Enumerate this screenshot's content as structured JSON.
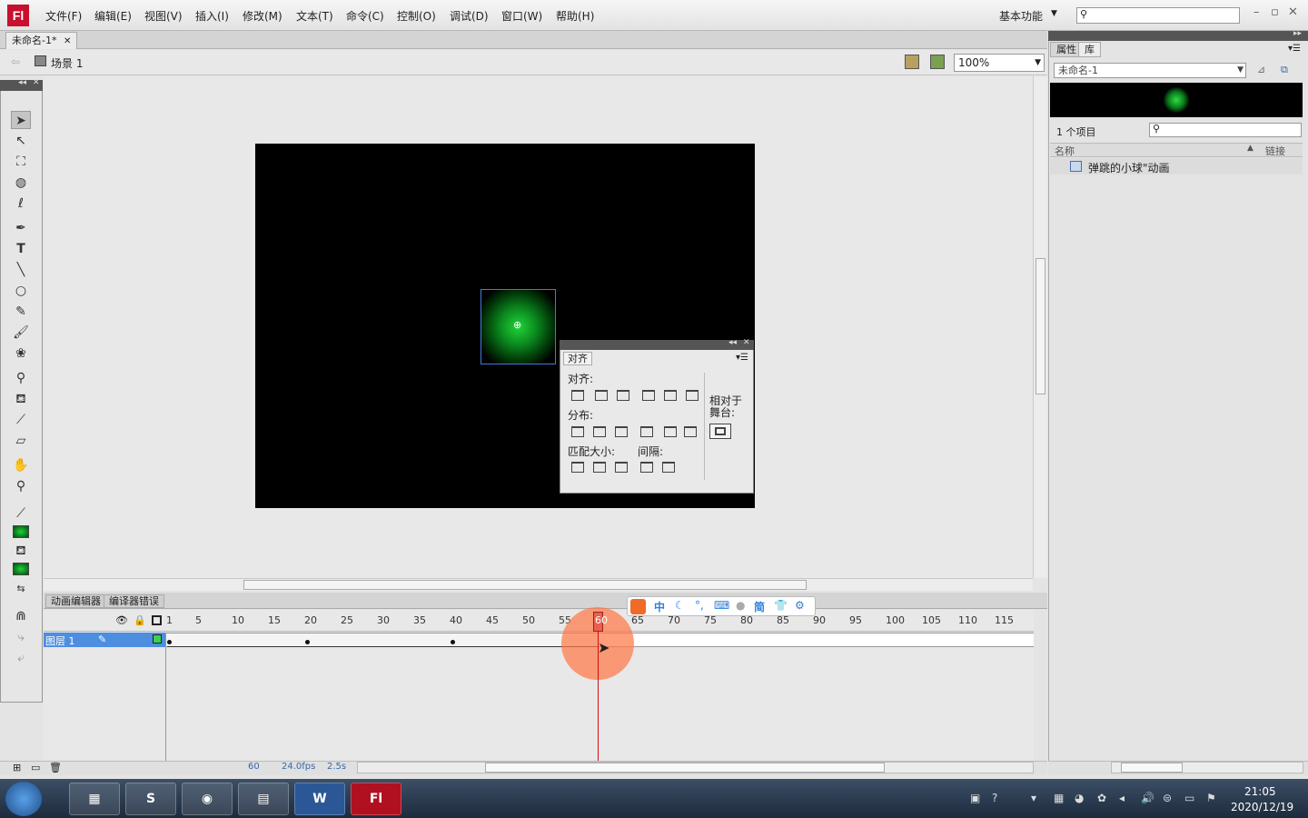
{
  "app": {
    "logo": "Fl"
  },
  "menu": [
    "文件(F)",
    "编辑(E)",
    "视图(V)",
    "插入(I)",
    "修改(M)",
    "文本(T)",
    "命令(C)",
    "控制(O)",
    "调试(D)",
    "窗口(W)",
    "帮助(H)"
  ],
  "workspace": {
    "label": "基本功能"
  },
  "document": {
    "tab": "未命名-1*",
    "close": "✕"
  },
  "scene": {
    "label": "场景 1",
    "zoom": "100%"
  },
  "align_panel": {
    "tab": "对齐",
    "align_label": "对齐:",
    "distribute_label": "分布:",
    "match_label": "匹配大小:",
    "space_label": "间隔:",
    "relative": "相对于\n舞台:"
  },
  "timeline": {
    "tabs": [
      "动画编辑器",
      "编译器错误"
    ],
    "frame_numbers": [
      "1",
      "5",
      "10",
      "15",
      "20",
      "25",
      "30",
      "35",
      "40",
      "45",
      "50",
      "55",
      "60",
      "65",
      "70",
      "75",
      "80",
      "85",
      "90",
      "95",
      "100",
      "105",
      "110",
      "115"
    ],
    "layer": "图层 1",
    "current_frame": "60",
    "fps": "24.0fps",
    "time": "2.5s"
  },
  "ime": {
    "items": [
      "中",
      "简"
    ]
  },
  "library": {
    "tabs": [
      "属性",
      "库"
    ],
    "doc": "未命名-1",
    "count": "1 个项目",
    "col_name": "名称",
    "col_link": "链接",
    "item": "弹跳的小球\"动画"
  },
  "taskbar": {
    "flash": "Fl",
    "word": "W",
    "time": "21:05",
    "date": "2020/12/19"
  }
}
